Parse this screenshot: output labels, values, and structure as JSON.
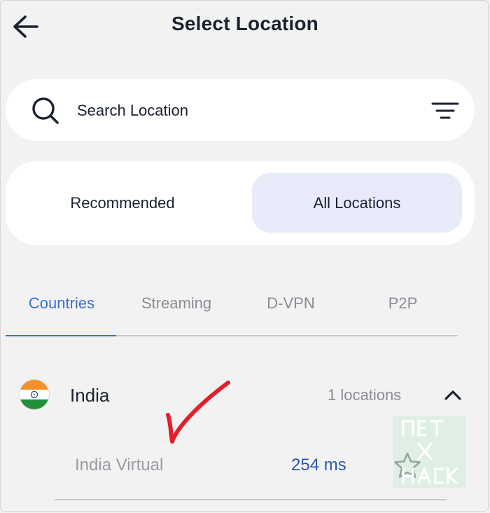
{
  "header": {
    "title": "Select Location",
    "back_icon": "arrow-left-icon"
  },
  "search": {
    "placeholder": "Search Location",
    "value": "",
    "search_icon": "search-icon",
    "filter_icon": "filter-icon"
  },
  "mode_toggle": {
    "options": [
      {
        "label": "Recommended",
        "selected": false
      },
      {
        "label": "All Locations",
        "selected": true
      }
    ]
  },
  "tabs": [
    {
      "label": "Countries",
      "active": true
    },
    {
      "label": "Streaming",
      "active": false
    },
    {
      "label": "D-VPN",
      "active": false
    },
    {
      "label": "P2P",
      "active": false
    }
  ],
  "countries": [
    {
      "name": "India",
      "flag_icon": "india-flag-icon",
      "locations_label": "1 locations",
      "expanded": true,
      "servers": [
        {
          "name": "India Virtual",
          "latency": "254 ms",
          "favorite": false
        }
      ]
    }
  ],
  "colors": {
    "accent": "#3d6fd1",
    "latency": "#2b57a8",
    "selected_mode_bg": "#e8ecfa",
    "background": "#f2f2f3",
    "checkmark": "#e0202a"
  }
}
